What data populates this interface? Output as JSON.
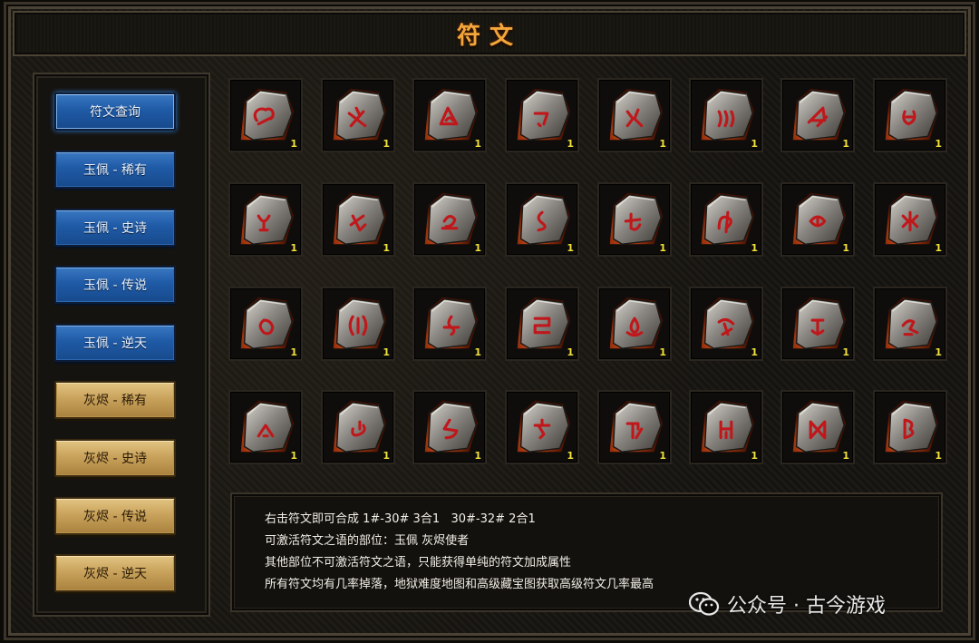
{
  "window": {
    "title": "符文"
  },
  "menu": [
    {
      "label": "符文查询",
      "style": "blue",
      "active": true
    },
    {
      "label": "玉佩 - 稀有",
      "style": "blue"
    },
    {
      "label": "玉佩 - 史诗",
      "style": "blue"
    },
    {
      "label": "玉佩 - 传说",
      "style": "blue"
    },
    {
      "label": "玉佩 - 逆天",
      "style": "blue"
    },
    {
      "label": "灰烬 - 稀有",
      "style": "gold"
    },
    {
      "label": "灰烬 - 史诗",
      "style": "gold"
    },
    {
      "label": "灰烬 - 传说",
      "style": "gold"
    },
    {
      "label": "灰烬 - 逆天",
      "style": "gold"
    }
  ],
  "runes": [
    {
      "glyph": "rune-01",
      "count": "1"
    },
    {
      "glyph": "rune-02",
      "count": "1"
    },
    {
      "glyph": "rune-03",
      "count": "1"
    },
    {
      "glyph": "rune-04",
      "count": "1"
    },
    {
      "glyph": "rune-05",
      "count": "1"
    },
    {
      "glyph": "rune-06",
      "count": "1"
    },
    {
      "glyph": "rune-07",
      "count": "1"
    },
    {
      "glyph": "rune-08",
      "count": "1"
    },
    {
      "glyph": "rune-09",
      "count": "1"
    },
    {
      "glyph": "rune-10",
      "count": "1"
    },
    {
      "glyph": "rune-11",
      "count": "1"
    },
    {
      "glyph": "rune-12",
      "count": "1"
    },
    {
      "glyph": "rune-13",
      "count": "1"
    },
    {
      "glyph": "rune-14",
      "count": "1"
    },
    {
      "glyph": "rune-15",
      "count": "1"
    },
    {
      "glyph": "rune-16",
      "count": "1"
    },
    {
      "glyph": "rune-17",
      "count": "1"
    },
    {
      "glyph": "rune-18",
      "count": "1"
    },
    {
      "glyph": "rune-19",
      "count": "1"
    },
    {
      "glyph": "rune-20",
      "count": "1"
    },
    {
      "glyph": "rune-21",
      "count": "1"
    },
    {
      "glyph": "rune-22",
      "count": "1"
    },
    {
      "glyph": "rune-23",
      "count": "1"
    },
    {
      "glyph": "rune-24",
      "count": "1"
    },
    {
      "glyph": "rune-25",
      "count": "1"
    },
    {
      "glyph": "rune-26",
      "count": "1"
    },
    {
      "glyph": "rune-27",
      "count": "1"
    },
    {
      "glyph": "rune-28",
      "count": "1"
    },
    {
      "glyph": "rune-29",
      "count": "1"
    },
    {
      "glyph": "rune-30",
      "count": "1"
    },
    {
      "glyph": "rune-31",
      "count": "1"
    },
    {
      "glyph": "rune-32",
      "count": "1"
    }
  ],
  "info": {
    "line1": "右击符文即可合成 1#-30# 3合1   30#-32# 2合1",
    "line2": "可激活符文之语的部位：玉佩 灰烬使者",
    "line3": "其他部位不可激活符文之语，只能获得单纯的符文加成属性",
    "line4": "所有符文均有几率掉落，地狱难度地图和高级藏宝图获取高级符文几率最高"
  },
  "watermark": {
    "text": "公众号 · 古今游戏",
    "icon": "wechat-icon"
  },
  "colors": {
    "title": "#f3a63b",
    "rune_mark": "#c0171b",
    "count": "#f2e23a"
  }
}
